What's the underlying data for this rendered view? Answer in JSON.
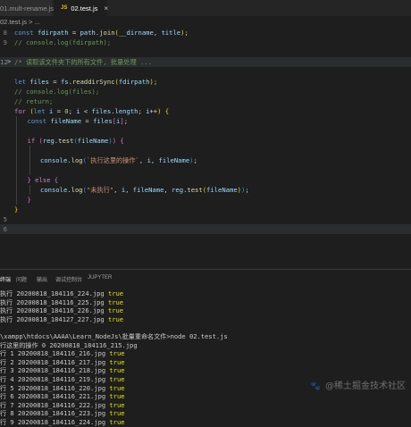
{
  "tabs": [
    {
      "label": "01.mult-rename.js",
      "active": false
    },
    {
      "label": "02.test.js",
      "active": true,
      "icon": "JS",
      "close": "×"
    }
  ],
  "breadcrumb": {
    "file": "02.test.js",
    "sep": ">",
    "rest": "..."
  },
  "editor": {
    "lines": [
      {
        "n": "8",
        "highlight": false,
        "fold": "",
        "indent": 0,
        "tokens": [
          [
            "k",
            "const "
          ],
          [
            "v",
            "fdirpath"
          ],
          [
            "p",
            " = "
          ],
          [
            "v",
            "path"
          ],
          [
            "p",
            "."
          ],
          [
            "f",
            "join"
          ],
          [
            "b1",
            "("
          ],
          [
            "v",
            "__dirname"
          ],
          [
            "p",
            ", "
          ],
          [
            "v",
            "title"
          ],
          [
            "b1",
            ")"
          ],
          [
            "p",
            ";"
          ]
        ]
      },
      {
        "n": "9",
        "highlight": false,
        "fold": "",
        "indent": 0,
        "tokens": [
          [
            "c",
            "// console.log(fdirpath);"
          ]
        ]
      },
      {
        "n": "",
        "highlight": false,
        "fold": "",
        "indent": 0,
        "tokens": []
      },
      {
        "n": "12",
        "highlight": true,
        "fold": ">",
        "indent": 0,
        "tokens": [
          [
            "c",
            "/* 读取该文件夹下的所有文件, 批量处理 ..."
          ]
        ]
      },
      {
        "n": "",
        "highlight": false,
        "fold": "",
        "indent": 0,
        "tokens": []
      },
      {
        "n": "",
        "highlight": false,
        "fold": "",
        "indent": 0,
        "tokens": [
          [
            "k",
            "let "
          ],
          [
            "v",
            "files"
          ],
          [
            "p",
            " = "
          ],
          [
            "v",
            "fs"
          ],
          [
            "p",
            "."
          ],
          [
            "f",
            "readdirSync"
          ],
          [
            "b1",
            "("
          ],
          [
            "v",
            "fdirpath"
          ],
          [
            "b1",
            ")"
          ],
          [
            "p",
            ";"
          ]
        ]
      },
      {
        "n": "",
        "highlight": false,
        "fold": "",
        "indent": 0,
        "tokens": [
          [
            "c",
            "// console.log(files);"
          ]
        ]
      },
      {
        "n": "",
        "highlight": false,
        "fold": "",
        "indent": 0,
        "tokens": [
          [
            "c",
            "// return;"
          ]
        ]
      },
      {
        "n": "",
        "highlight": false,
        "fold": "",
        "indent": 0,
        "tokens": [
          [
            "kc",
            "for "
          ],
          [
            "b1",
            "("
          ],
          [
            "k",
            "let "
          ],
          [
            "v",
            "i"
          ],
          [
            "p",
            " = "
          ],
          [
            "n",
            "0"
          ],
          [
            "p",
            "; "
          ],
          [
            "v",
            "i"
          ],
          [
            "p",
            " < "
          ],
          [
            "v",
            "files"
          ],
          [
            "p",
            "."
          ],
          [
            "v",
            "length"
          ],
          [
            "p",
            "; "
          ],
          [
            "v",
            "i"
          ],
          [
            "p",
            "++"
          ],
          [
            "b1",
            ")"
          ],
          [
            "p",
            " "
          ],
          [
            "b1",
            "{"
          ]
        ]
      },
      {
        "n": "",
        "highlight": false,
        "fold": "",
        "indent": 1,
        "tokens": [
          [
            "k",
            "const "
          ],
          [
            "v",
            "fileName"
          ],
          [
            "p",
            " = "
          ],
          [
            "v",
            "files"
          ],
          [
            "b2",
            "["
          ],
          [
            "v",
            "i"
          ],
          [
            "b2",
            "]"
          ],
          [
            "p",
            ";"
          ]
        ]
      },
      {
        "n": "",
        "highlight": false,
        "fold": "",
        "indent": 1,
        "tokens": []
      },
      {
        "n": "",
        "highlight": false,
        "fold": "",
        "indent": 1,
        "tokens": [
          [
            "kc",
            "if "
          ],
          [
            "b2",
            "("
          ],
          [
            "v",
            "reg"
          ],
          [
            "p",
            "."
          ],
          [
            "f",
            "test"
          ],
          [
            "b3",
            "("
          ],
          [
            "v",
            "fileName"
          ],
          [
            "b3",
            ")"
          ],
          [
            "b2",
            ")"
          ],
          [
            "p",
            " "
          ],
          [
            "b2",
            "{"
          ]
        ]
      },
      {
        "n": "",
        "highlight": false,
        "fold": "",
        "indent": 2,
        "tokens": []
      },
      {
        "n": "",
        "highlight": false,
        "fold": "",
        "indent": 2,
        "tokens": [
          [
            "v",
            "console"
          ],
          [
            "p",
            "."
          ],
          [
            "f",
            "log"
          ],
          [
            "b3",
            "("
          ],
          [
            "s",
            "`执行这里的操作`"
          ],
          [
            "p",
            ", "
          ],
          [
            "v",
            "i"
          ],
          [
            "p",
            ", "
          ],
          [
            "v",
            "fileName"
          ],
          [
            "b3",
            ")"
          ],
          [
            "p",
            ";"
          ]
        ]
      },
      {
        "n": "",
        "highlight": false,
        "fold": "",
        "indent": 2,
        "tokens": []
      },
      {
        "n": "",
        "highlight": false,
        "fold": "",
        "indent": 1,
        "tokens": [
          [
            "b2",
            "}"
          ],
          [
            "p",
            " "
          ],
          [
            "kc",
            "else "
          ],
          [
            "b2",
            "{"
          ]
        ]
      },
      {
        "n": "",
        "highlight": false,
        "fold": "",
        "indent": 2,
        "tokens": [
          [
            "v",
            "console"
          ],
          [
            "p",
            "."
          ],
          [
            "f",
            "log"
          ],
          [
            "b3",
            "("
          ],
          [
            "s",
            "\"未执行\""
          ],
          [
            "p",
            ", "
          ],
          [
            "v",
            "i"
          ],
          [
            "p",
            ", "
          ],
          [
            "v",
            "fileName"
          ],
          [
            "p",
            ", "
          ],
          [
            "v",
            "reg"
          ],
          [
            "p",
            "."
          ],
          [
            "f",
            "test"
          ],
          [
            "b1",
            "("
          ],
          [
            "v",
            "fileName"
          ],
          [
            "b1",
            ")"
          ],
          [
            "b3",
            ")"
          ],
          [
            "p",
            ";"
          ]
        ]
      },
      {
        "n": "",
        "highlight": false,
        "fold": "",
        "indent": 1,
        "tokens": [
          [
            "b2",
            "}"
          ]
        ]
      },
      {
        "n": "",
        "highlight": false,
        "fold": "",
        "indent": 0,
        "tokens": [
          [
            "b1",
            "}"
          ]
        ]
      },
      {
        "n": "5",
        "highlight": false,
        "fold": "",
        "indent": 0,
        "tokens": []
      },
      {
        "n": "6",
        "highlight": true,
        "fold": "",
        "indent": 0,
        "tokens": []
      }
    ]
  },
  "panel": {
    "tabs": [
      "问题",
      "输出",
      "调试控制台",
      "JUPYTER"
    ],
    "active_tab": "终端",
    "terminal_lines": [
      {
        "text": "执行 20200818_184116_224.jpg ",
        "bool": "true"
      },
      {
        "text": "执行 20200818_184116_225.jpg ",
        "bool": "true"
      },
      {
        "text": "执行 20200818_184116_226.jpg ",
        "bool": "true"
      },
      {
        "text": "执行 20200818_184127_227.jpg ",
        "bool": "true"
      },
      {
        "text": "",
        "bool": ""
      },
      {
        "text": "\\xampp\\htdocs\\AAAA\\Learn_NodeJs\\批量重命名文件>node 02.test.js",
        "bool": ""
      },
      {
        "text": "行这里的操作 0 20200818_184116_215.jpg",
        "bool": ""
      },
      {
        "text": "行 1 20200818_184116_216.jpg ",
        "bool": "true"
      },
      {
        "text": "行 2 20200818_184116_217.jpg ",
        "bool": "true"
      },
      {
        "text": "行 3 20200818_184116_218.jpg ",
        "bool": "true"
      },
      {
        "text": "行 4 20200818_184116_219.jpg ",
        "bool": "true"
      },
      {
        "text": "行 5 20200818_184116_220.jpg ",
        "bool": "true"
      },
      {
        "text": "行 6 20200818_184116_221.jpg ",
        "bool": "true"
      },
      {
        "text": "行 7 20200818_184116_222.jpg ",
        "bool": "true"
      },
      {
        "text": "行 8 20200818_184116_223.jpg ",
        "bool": "true"
      },
      {
        "text": "行 9 20200818_184116_224.jpg ",
        "bool": "true"
      }
    ]
  },
  "watermark": {
    "text": "@稀土掘金技术社区",
    "icon": "paw-icon"
  }
}
